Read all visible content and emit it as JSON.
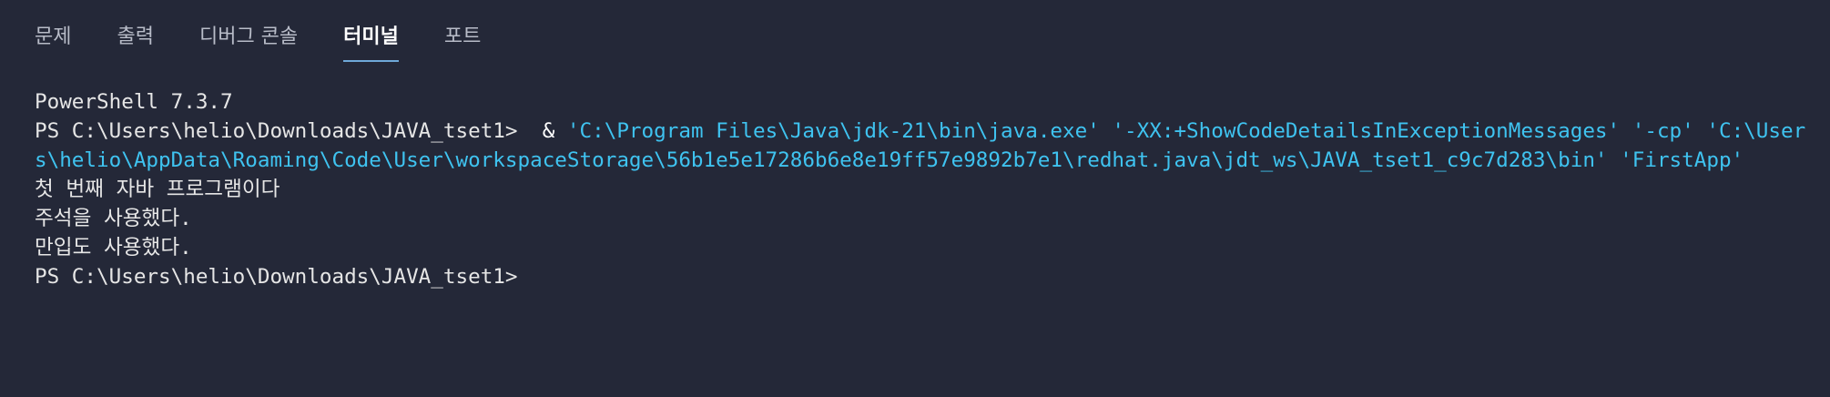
{
  "tabs": [
    {
      "label": "문제",
      "active": false
    },
    {
      "label": "출력",
      "active": false
    },
    {
      "label": "디버그 콘솔",
      "active": false
    },
    {
      "label": "터미널",
      "active": true
    },
    {
      "label": "포트",
      "active": false
    }
  ],
  "terminal": {
    "version_line": "PowerShell 7.3.7",
    "prompt1": "PS C:\\Users\\helio\\Downloads\\JAVA_tset1> ",
    "operator": " & ",
    "command": "'C:\\Program Files\\Java\\jdk-21\\bin\\java.exe' '-XX:+ShowCodeDetailsInExceptionMessages' '-cp' 'C:\\Users\\helio\\AppData\\Roaming\\Code\\User\\workspaceStorage\\56b1e5e17286b6e8e19ff57e9892b7e1\\redhat.java\\jdt_ws\\JAVA_tset1_c9c7d283\\bin' 'FirstApp'",
    "output": [
      "첫 번째 자바 프로그램이다",
      "주석을 사용했다.",
      "만입도 사용했다."
    ],
    "prompt2": "PS C:\\Users\\helio\\Downloads\\JAVA_tset1>"
  },
  "colors": {
    "background": "#242838",
    "command": "#3fc3f0",
    "text": "#e6e6e6",
    "active_tab_underline": "#6ea8d8"
  }
}
